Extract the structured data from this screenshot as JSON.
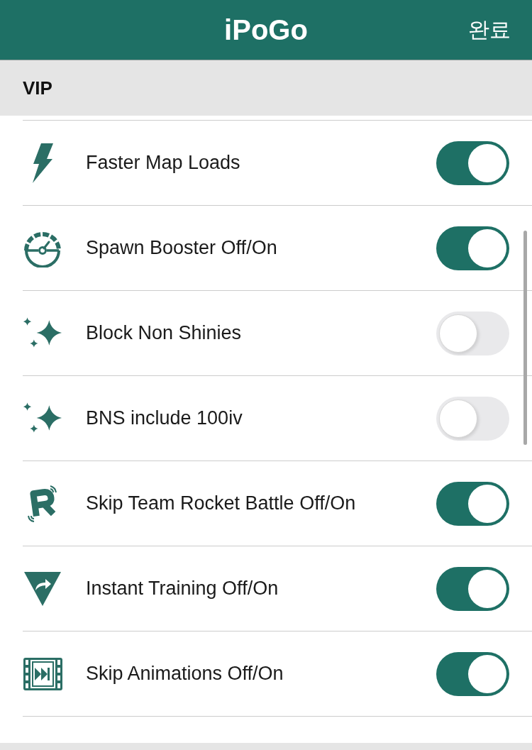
{
  "header": {
    "title": "iPoGo",
    "done_button": "완료"
  },
  "section": {
    "title": "VIP"
  },
  "settings": [
    {
      "label": "Faster Map Loads",
      "on": true
    },
    {
      "label": "Spawn Booster Off/On",
      "on": true
    },
    {
      "label": "Block Non Shinies",
      "on": false
    },
    {
      "label": "BNS include 100iv",
      "on": false
    },
    {
      "label": "Skip Team Rocket Battle Off/On",
      "on": true
    },
    {
      "label": "Instant Training Off/On",
      "on": true
    },
    {
      "label": "Skip Animations Off/On",
      "on": true
    }
  ]
}
